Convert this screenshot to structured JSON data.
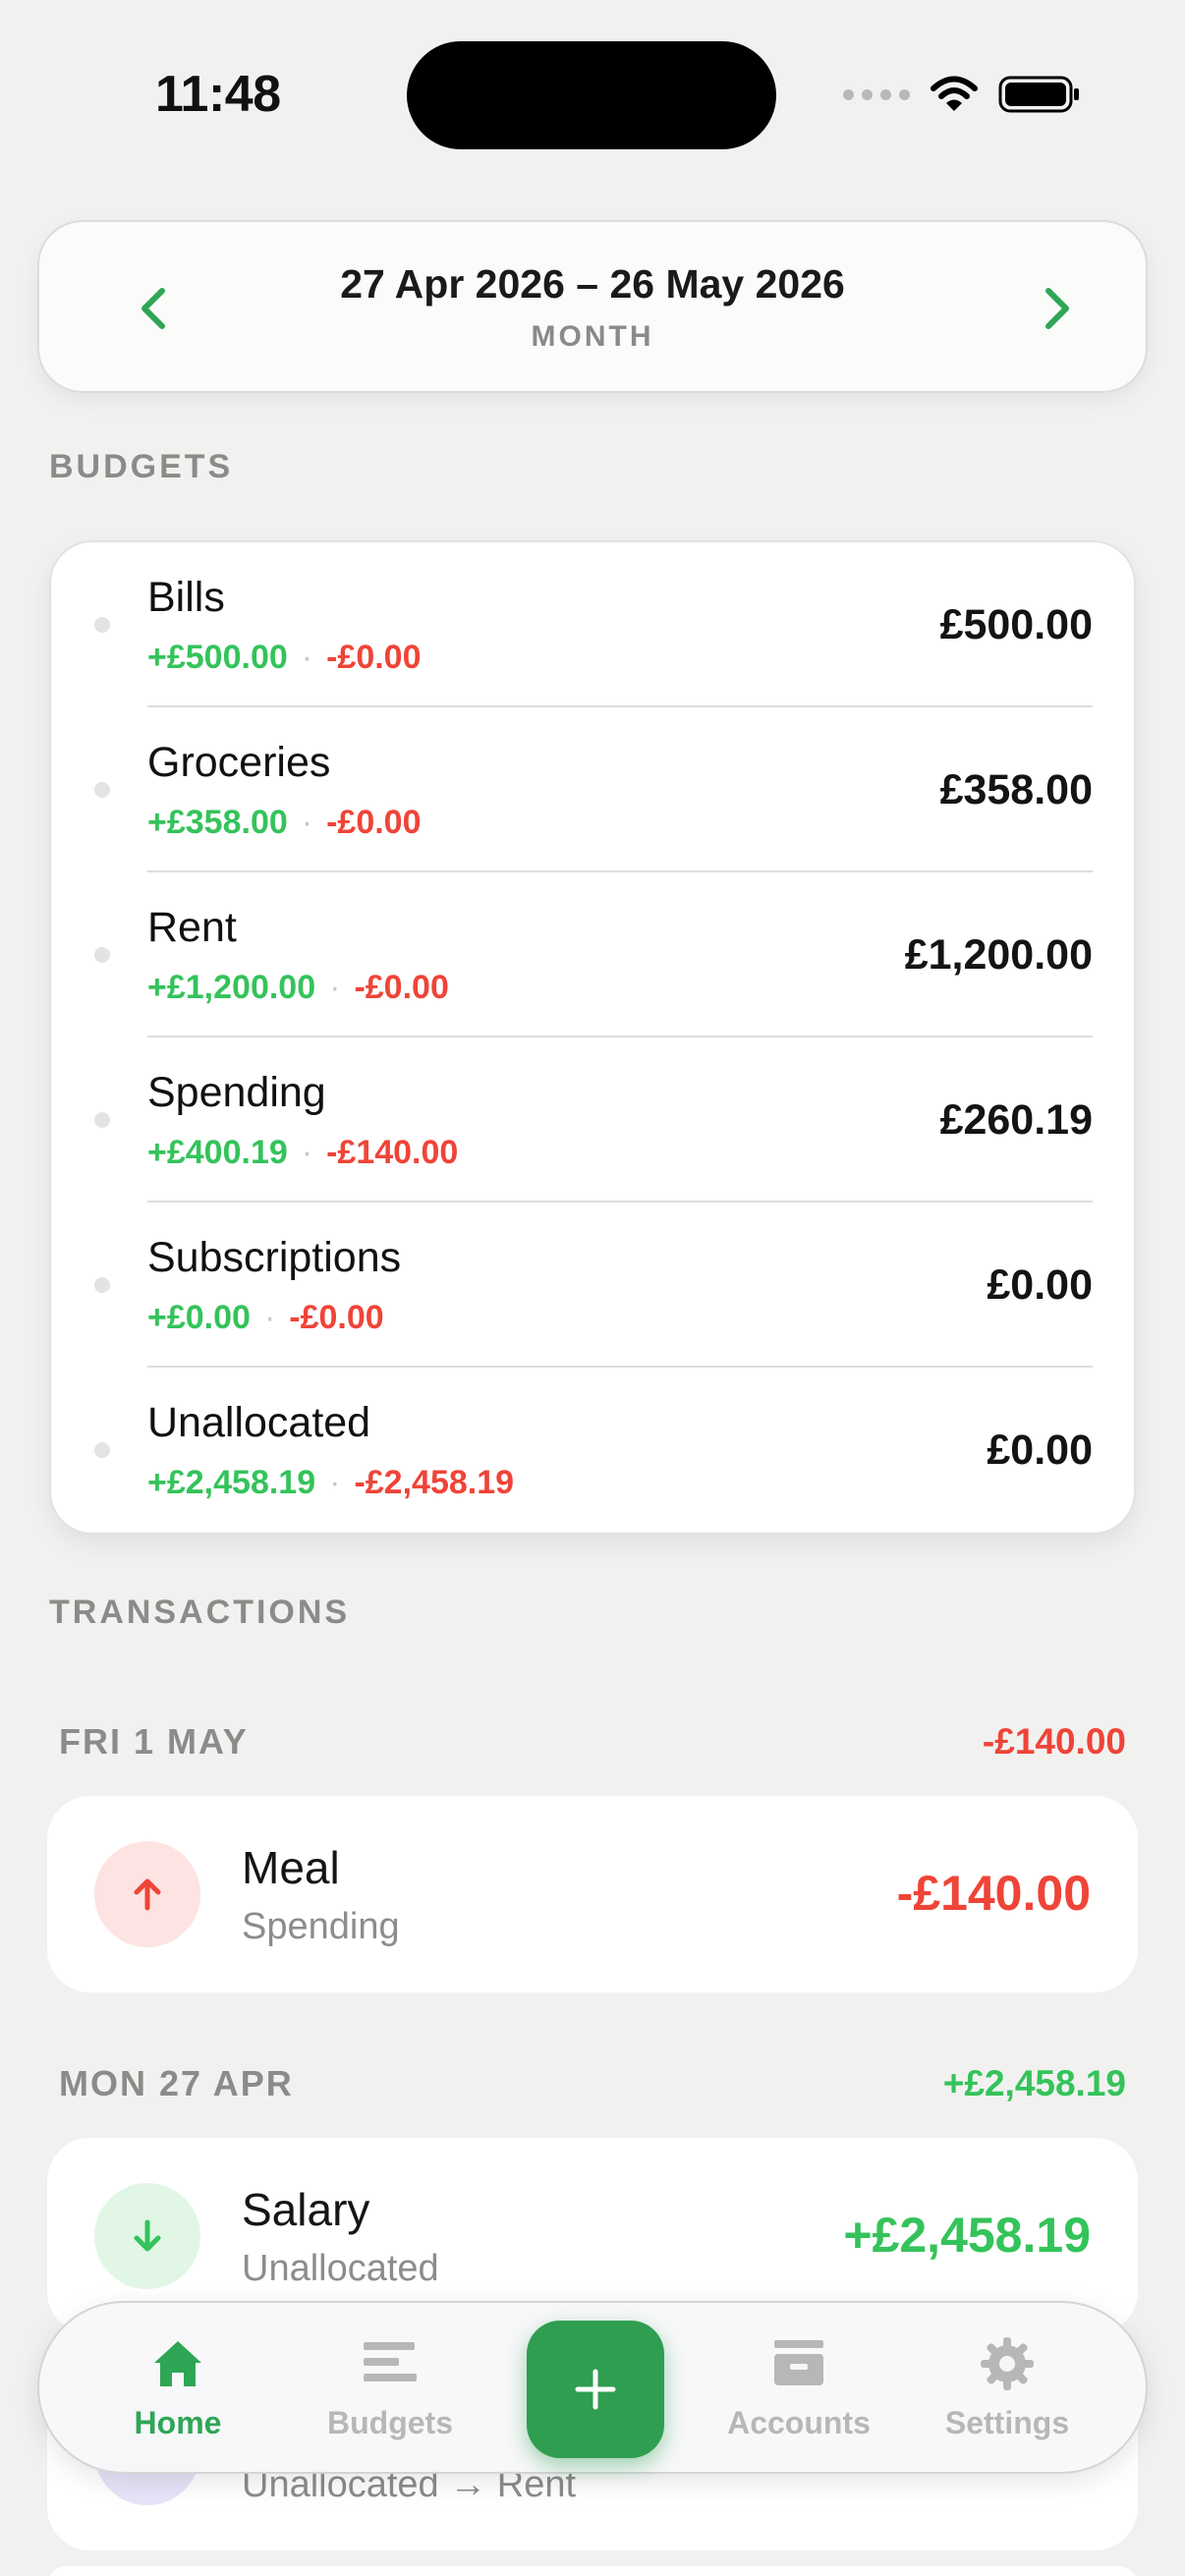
{
  "status": {
    "time": "11:48"
  },
  "period": {
    "range": "27 Apr 2026 – 26 May 2026",
    "unit": "MONTH"
  },
  "sections": {
    "budgets": "BUDGETS",
    "transactions": "TRANSACTIONS"
  },
  "budgets": [
    {
      "name": "Bills",
      "in": "+£500.00",
      "out": "-£0.00",
      "amount": "£500.00"
    },
    {
      "name": "Groceries",
      "in": "+£358.00",
      "out": "-£0.00",
      "amount": "£358.00"
    },
    {
      "name": "Rent",
      "in": "+£1,200.00",
      "out": "-£0.00",
      "amount": "£1,200.00"
    },
    {
      "name": "Spending",
      "in": "+£400.19",
      "out": "-£140.00",
      "amount": "£260.19"
    },
    {
      "name": "Subscriptions",
      "in": "+£0.00",
      "out": "-£0.00",
      "amount": "£0.00"
    },
    {
      "name": "Unallocated",
      "in": "+£2,458.19",
      "out": "-£2,458.19",
      "amount": "£0.00"
    }
  ],
  "transaction_days": [
    {
      "date": "FRI 1 MAY",
      "total": "-£140.00",
      "items": [
        {
          "name": "Meal",
          "budget": "Spending",
          "amount": "-£140.00",
          "icon": "arrow-up-icon"
        }
      ]
    },
    {
      "date": "MON 27 APR",
      "total": "+£2,458.19",
      "items": [
        {
          "name": "Salary",
          "budget": "Unallocated",
          "amount": "+£2,458.19",
          "icon": "arrow-down-icon"
        },
        {
          "name": "",
          "budget": "Unallocated → Rent",
          "amount": "",
          "icon": "transfer-icon"
        }
      ]
    }
  ],
  "tabs": {
    "home": "Home",
    "budgets": "Budgets",
    "accounts": "Accounts",
    "settings": "Settings"
  },
  "colors": {
    "accent": "#2ea655",
    "income": "#34c35a",
    "expense": "#ef4438",
    "background": "#f1f2f0"
  }
}
